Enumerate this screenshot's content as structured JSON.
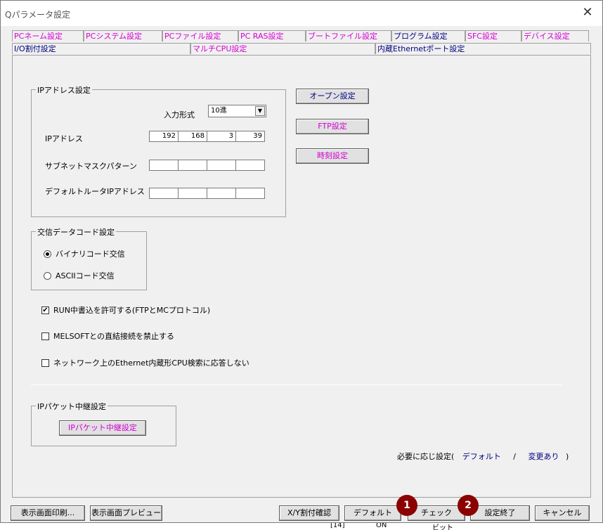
{
  "window": {
    "title": "Qパラメータ設定"
  },
  "tabs_row1": [
    {
      "label": "PCネーム設定"
    },
    {
      "label": "PCシステム設定"
    },
    {
      "label": "PCファイル設定"
    },
    {
      "label": "PC RAS設定"
    },
    {
      "label": "ブートファイル設定"
    },
    {
      "label": "プログラム設定"
    },
    {
      "label": "SFC設定"
    },
    {
      "label": "デバイス設定"
    }
  ],
  "tabs_row2": [
    {
      "label": "I/O割付設定"
    },
    {
      "label": "マルチCPU設定"
    },
    {
      "label": "内蔵Ethernetポート設定"
    }
  ],
  "ip_group": {
    "title": "IPアドレス設定",
    "input_format_label": "入力形式",
    "input_format_value": "10進",
    "ip_label": "IPアドレス",
    "ip_values": [
      "192",
      "168",
      "3",
      "39"
    ],
    "subnet_label": "サブネットマスクパターン",
    "subnet_values": [
      "",
      "",
      "",
      ""
    ],
    "gateway_label": "デフォルトルータIPアドレス",
    "gateway_values": [
      "",
      "",
      "",
      ""
    ]
  },
  "side_buttons": {
    "open": "オープン設定",
    "ftp": "FTP設定",
    "time": "時刻設定"
  },
  "code_group": {
    "title": "交信データコード設定",
    "binary": "バイナリコード交信",
    "ascii": "ASCIIコード交信"
  },
  "checks": {
    "run_write": "RUN中書込を許可する(FTPとMCプロトコル)",
    "melsoft": "MELSOFTとの直結接続を禁止する",
    "network": "ネットワーク上のEthernet内蔵形CPU検索に応答しない"
  },
  "relay_group": {
    "title": "IPパケット中継設定",
    "button": "IPパケット中継設定"
  },
  "legend": {
    "prefix": "必要に応じ設定(",
    "default": "デフォルト",
    "sep": "/",
    "changed": "変更あり",
    "suffix": ")"
  },
  "footer": {
    "print": "表示画面印刷...",
    "preview": "表示画面プレビュー",
    "xy": "X/Y割付確認",
    "default": "デフォルト",
    "check": "チェック",
    "finish": "設定終了",
    "cancel": "キャンセル"
  },
  "badges": {
    "one": "1",
    "two": "2"
  },
  "background": {
    "cell1": "[14]",
    "cell2": "ON",
    "cell3": "ビット"
  }
}
